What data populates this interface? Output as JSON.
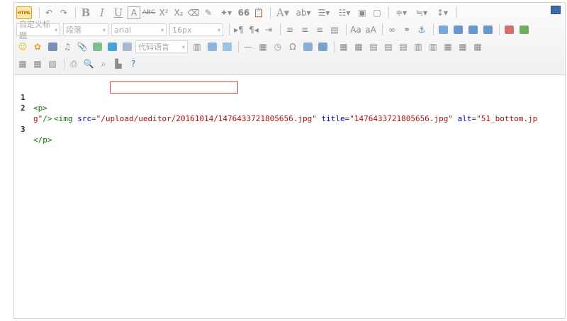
{
  "toolbar": {
    "html_label": "HTML",
    "bold_label": "B",
    "italic_label": "I",
    "underline_label": "U",
    "font_color_label": "A",
    "paragraph_format": "自定义标题",
    "paragraph": "段落",
    "font_family": "arial",
    "font_size": "16px",
    "code_language": "代码语言",
    "quote_label": "66"
  },
  "code": {
    "lines": [
      {
        "number": "1",
        "open_tag": "<p>"
      },
      {
        "number": "2",
        "tag_start": "<img",
        "attr_src": "src",
        "src_value": "\"/upload/ueditor/20161014/1476433721805656.jpg\"",
        "attr_title": "title",
        "title_value": "\"1476433721805656.jpg\"",
        "attr_alt": "alt",
        "alt_value_part1": "\"51_bottom.jp",
        "alt_value_part2": "g\"",
        "tag_end": "/>"
      },
      {
        "number": "3",
        "close_tag": "</p>"
      }
    ],
    "highlight_note": "/upload/ueditor/20161014/"
  },
  "colors": {
    "highlight_border": "#e23c3c",
    "tag": "#117700",
    "attr": "#0000cc",
    "string": "#aa1111"
  }
}
